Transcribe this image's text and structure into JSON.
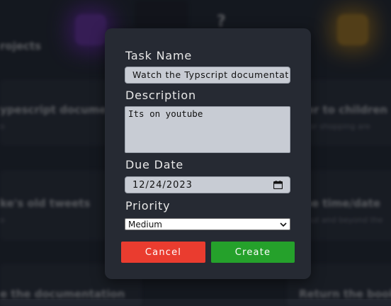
{
  "background": {
    "cards": [
      {
        "title": "rojects"
      },
      {
        "title": "ypescript documen",
        "sub": "o"
      },
      {
        "title": "ke's old tweets",
        "sub": "o"
      },
      {
        "title": "e the documentation"
      },
      {
        "title": "der to children",
        "sub": "0 for shopping are"
      },
      {
        "title": "the time/date",
        "sub": "u out and beyond the"
      },
      {
        "title": "Return the book"
      }
    ],
    "question_mark": "?"
  },
  "modal": {
    "task_name_label": "Task Name",
    "task_name_value": "Watch the Typscript documentation",
    "description_label": "Description",
    "description_value": "Its on youtube",
    "due_date_label": "Due Date",
    "due_date_value": "12/24/2023",
    "priority_label": "Priority",
    "priority_value": "Medium",
    "cancel_label": "Cancel",
    "create_label": "Create"
  },
  "colors": {
    "cancel": "#ea3c2f",
    "create": "#25a12b",
    "modal_bg": "#262a33"
  }
}
